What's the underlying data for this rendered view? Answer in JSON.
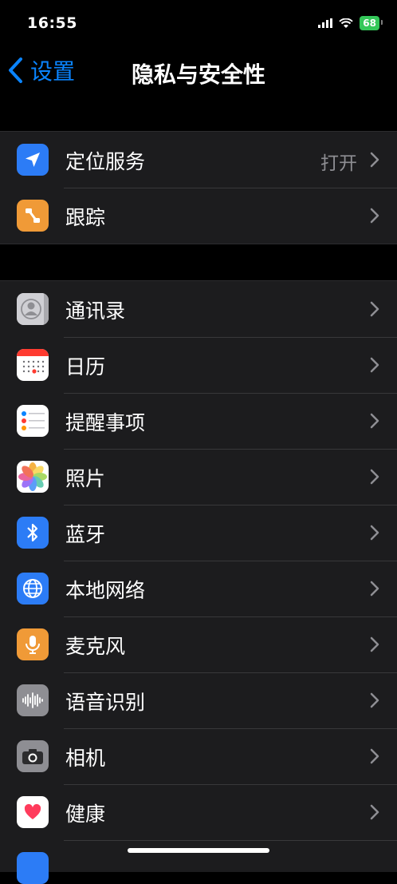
{
  "status": {
    "time": "16:55",
    "battery": "68"
  },
  "nav": {
    "back_label": "设置",
    "title": "隐私与安全性"
  },
  "groups": [
    {
      "items": [
        {
          "label": "定位服务",
          "value": "打开",
          "icon": "location-arrow-icon",
          "color": "#2c7cf6"
        },
        {
          "label": "跟踪",
          "icon": "tracking-icon",
          "color": "#f09a37"
        }
      ]
    },
    {
      "items": [
        {
          "label": "通讯录",
          "icon": "contacts-icon",
          "color": "#d1d1d6"
        },
        {
          "label": "日历",
          "icon": "calendar-icon",
          "color": "#ffffff"
        },
        {
          "label": "提醒事项",
          "icon": "reminders-icon",
          "color": "#ffffff"
        },
        {
          "label": "照片",
          "icon": "photos-icon",
          "color": "#ffffff"
        },
        {
          "label": "蓝牙",
          "icon": "bluetooth-icon",
          "color": "#2c7cf6"
        },
        {
          "label": "本地网络",
          "icon": "globe-icon",
          "color": "#2c7cf6"
        },
        {
          "label": "麦克风",
          "icon": "microphone-icon",
          "color": "#f09a37"
        },
        {
          "label": "语音识别",
          "icon": "waveform-icon",
          "color": "#8e8e93"
        },
        {
          "label": "相机",
          "icon": "camera-icon",
          "color": "#8e8e93"
        },
        {
          "label": "健康",
          "icon": "heart-icon",
          "color": "#ffffff"
        }
      ]
    }
  ]
}
